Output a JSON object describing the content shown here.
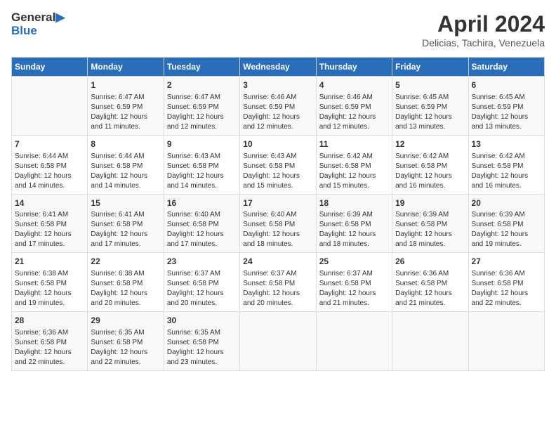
{
  "header": {
    "logo_line1": "General",
    "logo_line2": "Blue",
    "month_title": "April 2024",
    "subtitle": "Delicias, Tachira, Venezuela"
  },
  "days_of_week": [
    "Sunday",
    "Monday",
    "Tuesday",
    "Wednesday",
    "Thursday",
    "Friday",
    "Saturday"
  ],
  "weeks": [
    [
      {
        "day": "",
        "info": ""
      },
      {
        "day": "1",
        "info": "Sunrise: 6:47 AM\nSunset: 6:59 PM\nDaylight: 12 hours and 11 minutes."
      },
      {
        "day": "2",
        "info": "Sunrise: 6:47 AM\nSunset: 6:59 PM\nDaylight: 12 hours and 12 minutes."
      },
      {
        "day": "3",
        "info": "Sunrise: 6:46 AM\nSunset: 6:59 PM\nDaylight: 12 hours and 12 minutes."
      },
      {
        "day": "4",
        "info": "Sunrise: 6:46 AM\nSunset: 6:59 PM\nDaylight: 12 hours and 12 minutes."
      },
      {
        "day": "5",
        "info": "Sunrise: 6:45 AM\nSunset: 6:59 PM\nDaylight: 12 hours and 13 minutes."
      },
      {
        "day": "6",
        "info": "Sunrise: 6:45 AM\nSunset: 6:59 PM\nDaylight: 12 hours and 13 minutes."
      }
    ],
    [
      {
        "day": "7",
        "info": "Sunrise: 6:44 AM\nSunset: 6:58 PM\nDaylight: 12 hours and 14 minutes."
      },
      {
        "day": "8",
        "info": "Sunrise: 6:44 AM\nSunset: 6:58 PM\nDaylight: 12 hours and 14 minutes."
      },
      {
        "day": "9",
        "info": "Sunrise: 6:43 AM\nSunset: 6:58 PM\nDaylight: 12 hours and 14 minutes."
      },
      {
        "day": "10",
        "info": "Sunrise: 6:43 AM\nSunset: 6:58 PM\nDaylight: 12 hours and 15 minutes."
      },
      {
        "day": "11",
        "info": "Sunrise: 6:42 AM\nSunset: 6:58 PM\nDaylight: 12 hours and 15 minutes."
      },
      {
        "day": "12",
        "info": "Sunrise: 6:42 AM\nSunset: 6:58 PM\nDaylight: 12 hours and 16 minutes."
      },
      {
        "day": "13",
        "info": "Sunrise: 6:42 AM\nSunset: 6:58 PM\nDaylight: 12 hours and 16 minutes."
      }
    ],
    [
      {
        "day": "14",
        "info": "Sunrise: 6:41 AM\nSunset: 6:58 PM\nDaylight: 12 hours and 17 minutes."
      },
      {
        "day": "15",
        "info": "Sunrise: 6:41 AM\nSunset: 6:58 PM\nDaylight: 12 hours and 17 minutes."
      },
      {
        "day": "16",
        "info": "Sunrise: 6:40 AM\nSunset: 6:58 PM\nDaylight: 12 hours and 17 minutes."
      },
      {
        "day": "17",
        "info": "Sunrise: 6:40 AM\nSunset: 6:58 PM\nDaylight: 12 hours and 18 minutes."
      },
      {
        "day": "18",
        "info": "Sunrise: 6:39 AM\nSunset: 6:58 PM\nDaylight: 12 hours and 18 minutes."
      },
      {
        "day": "19",
        "info": "Sunrise: 6:39 AM\nSunset: 6:58 PM\nDaylight: 12 hours and 18 minutes."
      },
      {
        "day": "20",
        "info": "Sunrise: 6:39 AM\nSunset: 6:58 PM\nDaylight: 12 hours and 19 minutes."
      }
    ],
    [
      {
        "day": "21",
        "info": "Sunrise: 6:38 AM\nSunset: 6:58 PM\nDaylight: 12 hours and 19 minutes."
      },
      {
        "day": "22",
        "info": "Sunrise: 6:38 AM\nSunset: 6:58 PM\nDaylight: 12 hours and 20 minutes."
      },
      {
        "day": "23",
        "info": "Sunrise: 6:37 AM\nSunset: 6:58 PM\nDaylight: 12 hours and 20 minutes."
      },
      {
        "day": "24",
        "info": "Sunrise: 6:37 AM\nSunset: 6:58 PM\nDaylight: 12 hours and 20 minutes."
      },
      {
        "day": "25",
        "info": "Sunrise: 6:37 AM\nSunset: 6:58 PM\nDaylight: 12 hours and 21 minutes."
      },
      {
        "day": "26",
        "info": "Sunrise: 6:36 AM\nSunset: 6:58 PM\nDaylight: 12 hours and 21 minutes."
      },
      {
        "day": "27",
        "info": "Sunrise: 6:36 AM\nSunset: 6:58 PM\nDaylight: 12 hours and 22 minutes."
      }
    ],
    [
      {
        "day": "28",
        "info": "Sunrise: 6:36 AM\nSunset: 6:58 PM\nDaylight: 12 hours and 22 minutes."
      },
      {
        "day": "29",
        "info": "Sunrise: 6:35 AM\nSunset: 6:58 PM\nDaylight: 12 hours and 22 minutes."
      },
      {
        "day": "30",
        "info": "Sunrise: 6:35 AM\nSunset: 6:58 PM\nDaylight: 12 hours and 23 minutes."
      },
      {
        "day": "",
        "info": ""
      },
      {
        "day": "",
        "info": ""
      },
      {
        "day": "",
        "info": ""
      },
      {
        "day": "",
        "info": ""
      }
    ]
  ]
}
